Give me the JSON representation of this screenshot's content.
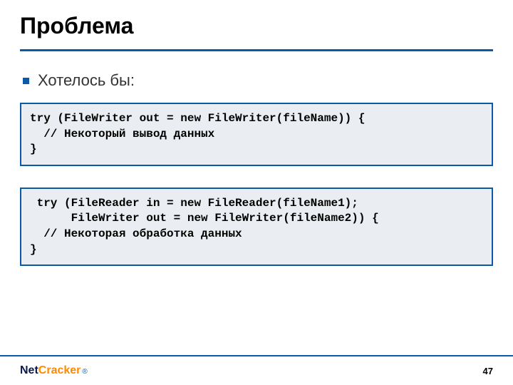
{
  "title": "Проблема",
  "bullet": "Хотелось бы:",
  "code1": "try (FileWriter out = new FileWriter(fileName)) {\n  // Некоторый вывод данных\n}",
  "code2": " try (FileReader in = new FileReader(fileName1);\n      FileWriter out = new FileWriter(fileName2)) {\n  // Некоторая обработка данных\n}",
  "logo": {
    "part1": "Net",
    "part2": "Cracker",
    "reg": "®"
  },
  "page": "47"
}
